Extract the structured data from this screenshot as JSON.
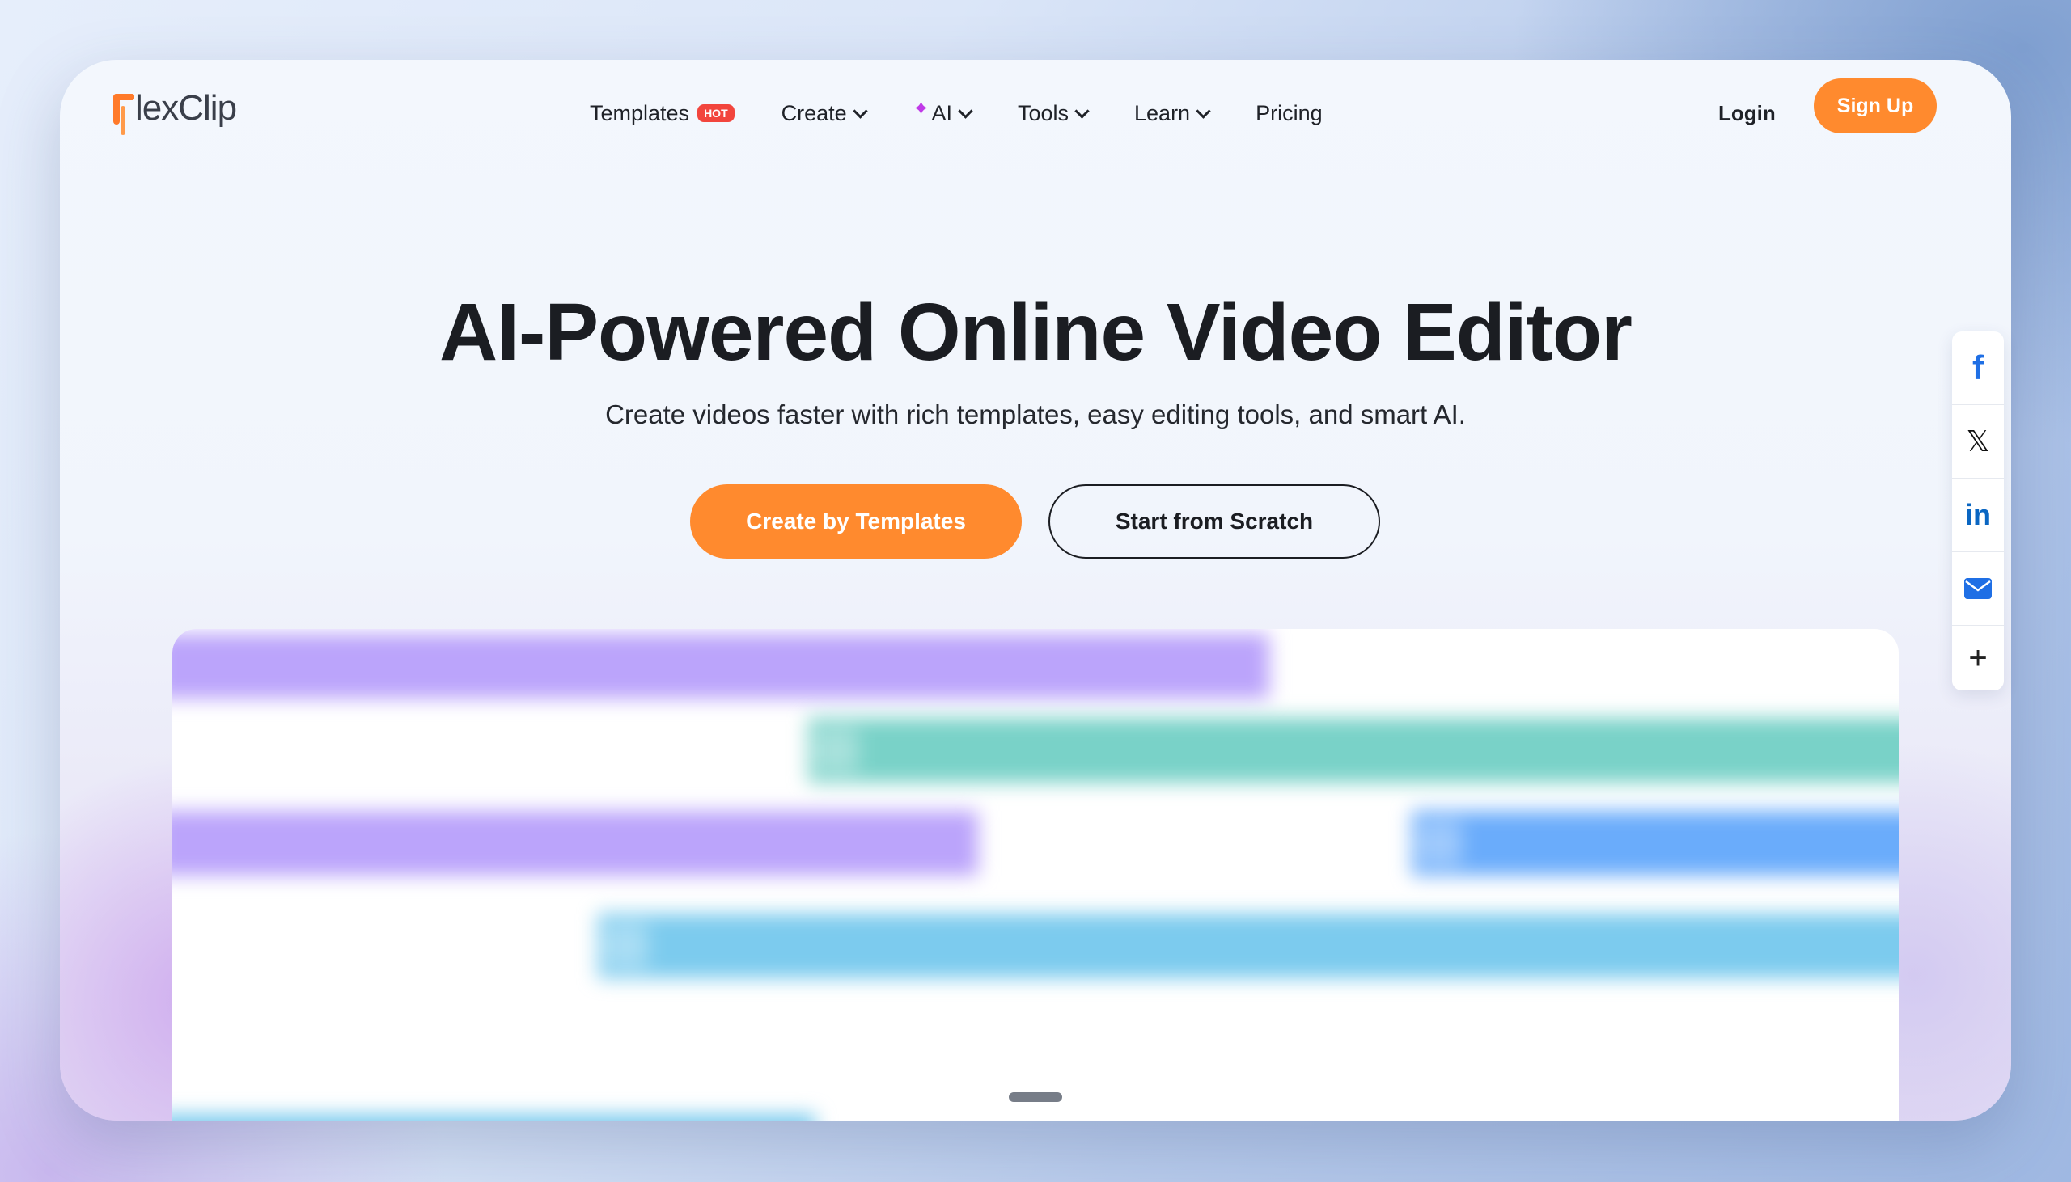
{
  "header": {
    "logo_text": "lexClip",
    "nav": [
      {
        "label": "Templates",
        "badge": "HOT"
      },
      {
        "label": "Create"
      },
      {
        "label": "AI"
      },
      {
        "label": "Tools"
      },
      {
        "label": "Learn"
      },
      {
        "label": "Pricing"
      }
    ],
    "login_label": "Login",
    "signup_label": "Sign Up"
  },
  "hero": {
    "title": "AI-Powered Online Video Editor",
    "subtitle": "Create videos faster with rich templates, easy editing tools, and smart AI.",
    "primary_cta": "Create by Templates",
    "secondary_cta": "Start from Scratch"
  },
  "share": {
    "icons": [
      "facebook-icon",
      "x-icon",
      "linkedin-icon",
      "email-icon",
      "plus-icon"
    ],
    "facebook_glyph": "f",
    "x_glyph": "𝕏",
    "linkedin_glyph": "in",
    "plus_glyph": "+"
  },
  "colors": {
    "accent": "#ff8a2e",
    "hot_badge": "#f2453d",
    "ai_sparkle": "#c03ae8",
    "purple_track": "#bba4fb",
    "teal_track": "#79d2c8",
    "blue_track": "#6aacfb",
    "sky_track": "#7ccbee"
  }
}
